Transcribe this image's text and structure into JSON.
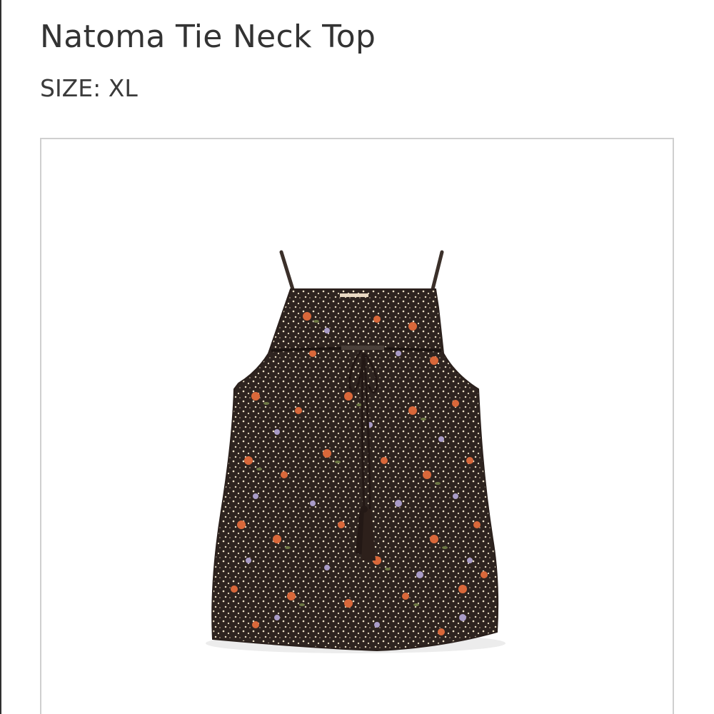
{
  "product": {
    "title": "Natoma Tie Neck Top",
    "size_label": "SIZE:",
    "size_value": "XL"
  },
  "image": {
    "subject": "garment-photo",
    "colors": {
      "fabric": "#2e2420",
      "flower_orange": "#d9683a",
      "flower_lavender": "#a99cc8",
      "dot_cream": "#efe3c8",
      "leaf_green": "#6e7a45",
      "tie": "#231815"
    }
  }
}
